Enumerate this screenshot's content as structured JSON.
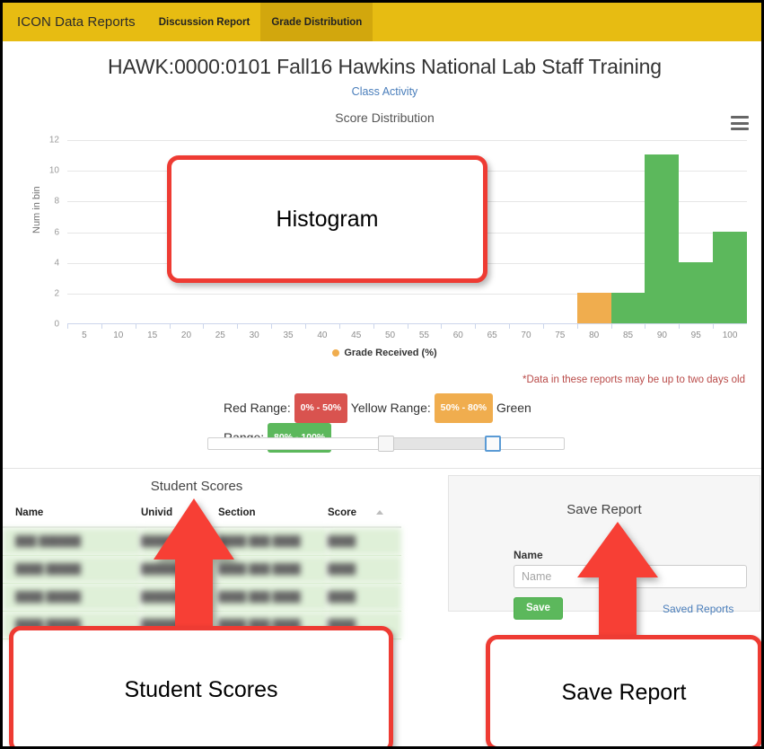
{
  "navbar": {
    "brand": "ICON Data Reports",
    "tabs": [
      {
        "label": "Discussion Report",
        "active": false
      },
      {
        "label": "Grade Distribution",
        "active": true
      }
    ],
    "background_color": "#e7bc12",
    "active_tab_color": "#d2a70d"
  },
  "header": {
    "title": "HAWK:0000:0101 Fall16 Hawkins National Lab Staff Training",
    "subtitle_link": "Class Activity"
  },
  "chart_data": {
    "type": "bar",
    "title": "Score Distribution",
    "xlabel": "",
    "ylabel": "Num in bin",
    "legend": "Grade Received (%)",
    "legend_position": "bottom",
    "legend_marker_color": "#f0ad4e",
    "grid": true,
    "xlim": [
      2.5,
      102.5
    ],
    "ylim": [
      0,
      12
    ],
    "xticks": [
      5,
      10,
      15,
      20,
      25,
      30,
      35,
      40,
      45,
      50,
      55,
      60,
      65,
      70,
      75,
      80,
      85,
      90,
      95,
      100
    ],
    "yticks": [
      0,
      2,
      4,
      6,
      8,
      10,
      12
    ],
    "bin_width": 5,
    "bars": [
      {
        "bin_start": 77.5,
        "bin_end": 82.5,
        "center": 80,
        "value": 2,
        "color": "#f0ad4e"
      },
      {
        "bin_start": 82.5,
        "bin_end": 87.5,
        "center": 85,
        "value": 2,
        "color": "#5cb85c"
      },
      {
        "bin_start": 87.5,
        "bin_end": 92.5,
        "center": 90,
        "value": 11,
        "color": "#5cb85c"
      },
      {
        "bin_start": 92.5,
        "bin_end": 97.5,
        "center": 95,
        "value": 4,
        "color": "#5cb85c"
      },
      {
        "bin_start": 97.5,
        "bin_end": 102.5,
        "center": 100,
        "value": 6,
        "color": "#5cb85c"
      }
    ],
    "menu_icon": "hamburger-menu-icon"
  },
  "data_warning": "*Data in these reports may be up to two days old",
  "range_legend": {
    "red_label": "Red Range:",
    "red_value": "0% - 50%",
    "red_color": "#d9534f",
    "yellow_label": "Yellow Range:",
    "yellow_value": "50% - 80%",
    "yellow_color": "#f0ad4e",
    "green_label": "Green Range:",
    "green_value": "80% - 100%",
    "green_color": "#5cb85c"
  },
  "slider": {
    "min": 0,
    "max": 100,
    "lower_handle": 50,
    "upper_handle": 80,
    "focused_handle": "upper"
  },
  "student_scores": {
    "title": "Student Scores",
    "columns": [
      "Name",
      "Univid",
      "Section",
      "Score"
    ],
    "sorted_column": "Score",
    "sort_direction": "ascending",
    "rows": [
      {
        "name": "███ ██████",
        "univid": "██████",
        "section": "████ ███ ████",
        "score": "████"
      },
      {
        "name": "████ █████",
        "univid": "██████",
        "section": "████ ███ ████",
        "score": "████"
      },
      {
        "name": "████ █████",
        "univid": "███████",
        "section": "████ ███ ████",
        "score": "████"
      },
      {
        "name": "████ █████",
        "univid": "███████",
        "section": "████ ███ ████",
        "score": "████"
      }
    ],
    "row_highlight_color": "#dff0d8"
  },
  "save_report": {
    "title": "Save Report",
    "name_label": "Name",
    "name_value": "",
    "name_placeholder": "Name",
    "save_button": "Save",
    "save_button_color": "#5cb85c",
    "saved_reports_link": "Saved Reports"
  },
  "annotations": {
    "histogram": "Histogram",
    "student_scores": "Student Scores",
    "save_report": "Save Report",
    "color": "#ee3b33"
  }
}
